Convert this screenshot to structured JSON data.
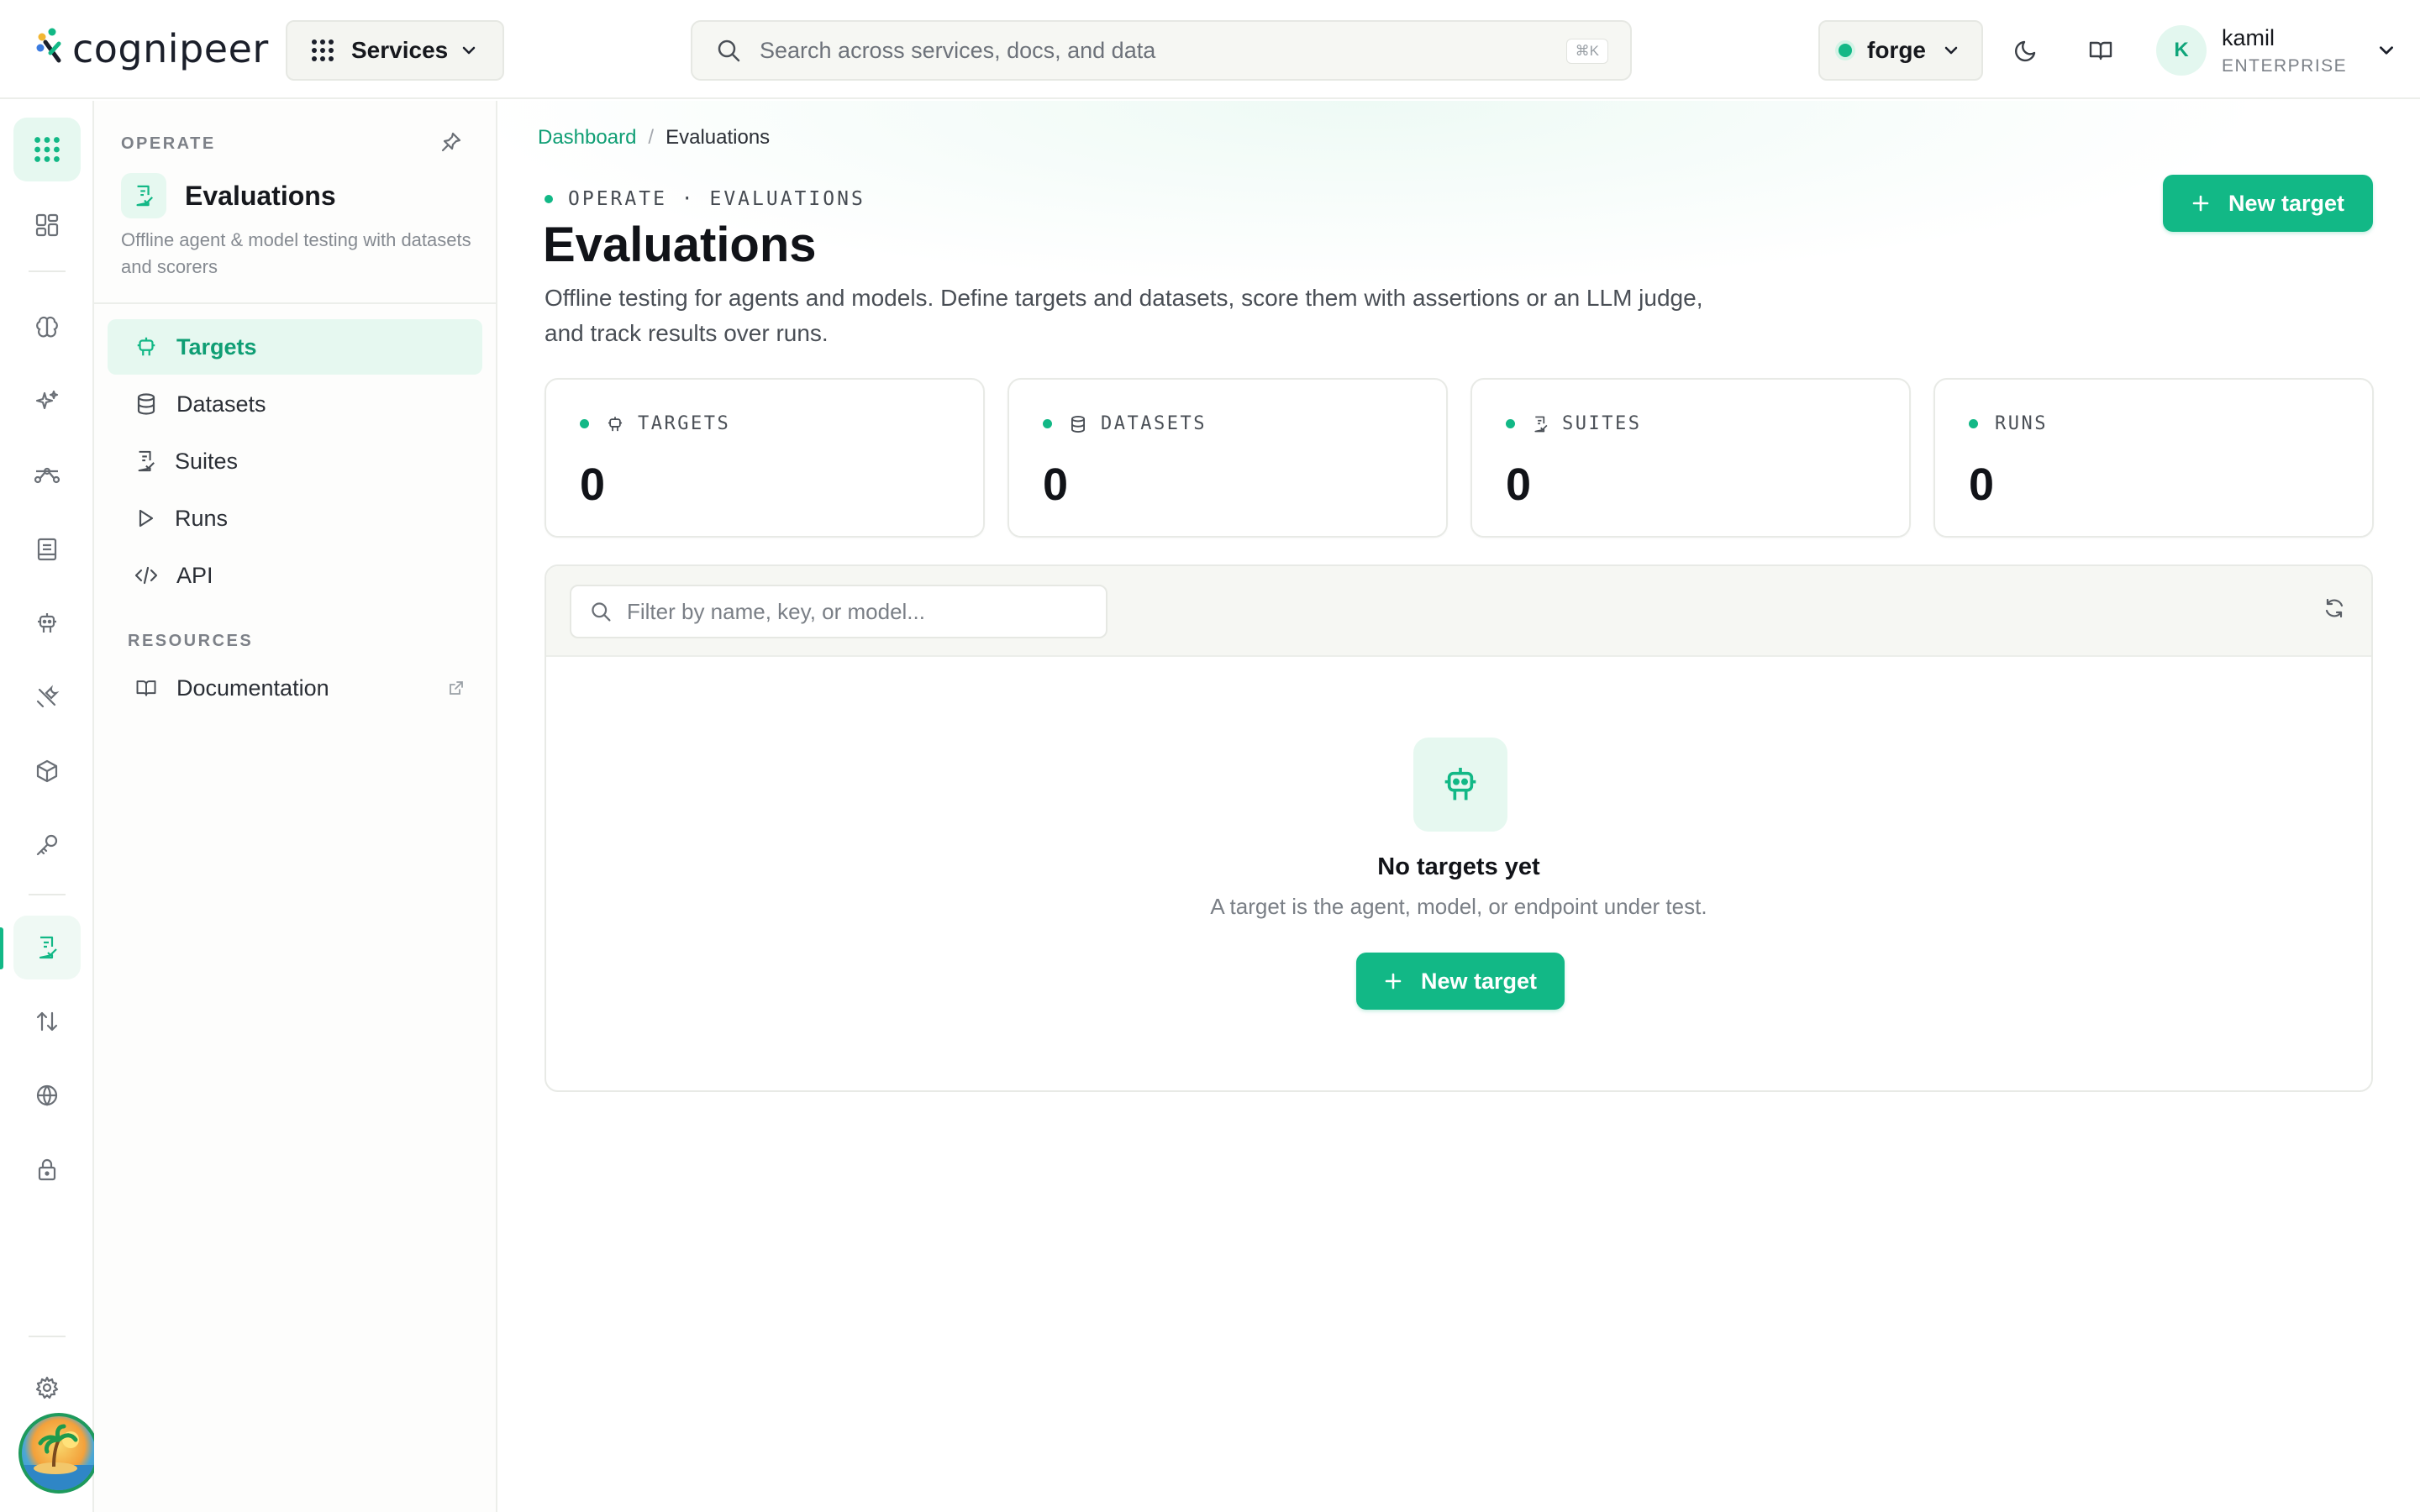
{
  "brand": {
    "name": "cognipeer"
  },
  "topbar": {
    "services_label": "Services",
    "search_placeholder": "Search across services, docs, and data",
    "search_shortcut": "⌘K",
    "environment": "forge",
    "user": {
      "initial": "K",
      "name": "kamil",
      "tier": "ENTERPRISE"
    }
  },
  "rail": {
    "items": [
      "grid-dots-icon",
      "dashboard-icon",
      "brain-icon",
      "sparkles-icon",
      "workflow-icon",
      "notebook-icon",
      "robot-icon",
      "tools-icon",
      "cube-icon",
      "key-icon",
      "evaluations-icon",
      "transfer-icon",
      "globe-icon",
      "lock-icon",
      "settings-icon"
    ]
  },
  "sidebar": {
    "section": "OPERATE",
    "title": "Evaluations",
    "description": "Offline agent & model testing with datasets and scorers",
    "items": [
      {
        "label": "Targets",
        "icon": "robot-icon",
        "active": true
      },
      {
        "label": "Datasets",
        "icon": "database-icon"
      },
      {
        "label": "Suites",
        "icon": "checklist-icon"
      },
      {
        "label": "Runs",
        "icon": "play-icon"
      },
      {
        "label": "API",
        "icon": "code-icon"
      }
    ],
    "resources_label": "RESOURCES",
    "resources": [
      {
        "label": "Documentation",
        "icon": "book-icon",
        "external": true
      }
    ]
  },
  "breadcrumb": {
    "parent": "Dashboard",
    "separator": "/",
    "current": "Evaluations"
  },
  "header": {
    "eyebrow": "OPERATE · EVALUATIONS",
    "title": "Evaluations",
    "description": "Offline testing for agents and models. Define targets and datasets, score them with assertions or an LLM judge, and track results over runs.",
    "new_target_label": "New target"
  },
  "stats": [
    {
      "label": "TARGETS",
      "value": "0",
      "icon": "robot-icon"
    },
    {
      "label": "DATASETS",
      "value": "0",
      "icon": "database-icon"
    },
    {
      "label": "SUITES",
      "value": "0",
      "icon": "checklist-icon"
    },
    {
      "label": "RUNS",
      "value": "0",
      "icon": ""
    }
  ],
  "panel": {
    "filter_placeholder": "Filter by name, key, or model...",
    "empty_title": "No targets yet",
    "empty_description": "A target is the agent, model, or endpoint under test.",
    "empty_button_label": "New target"
  },
  "colors": {
    "accent": "#12b886",
    "accent_soft": "#e6f8f0",
    "text": "#16181d",
    "muted": "#7a7f86"
  }
}
